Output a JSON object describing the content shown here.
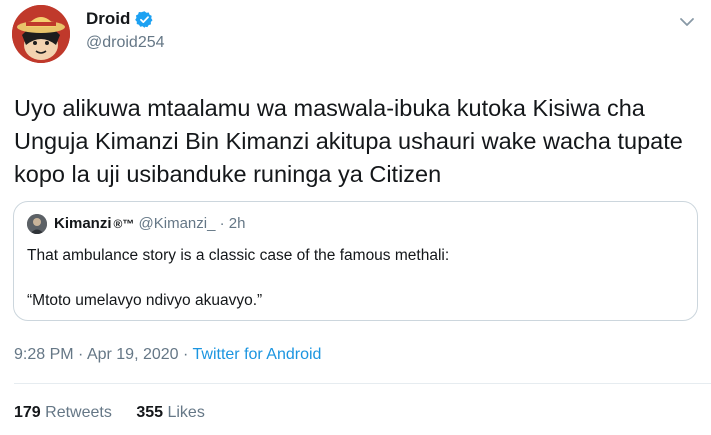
{
  "author": {
    "name": "Droid",
    "handle": "@droid254",
    "verified": true
  },
  "tweet": {
    "text": "Uyo alikuwa mtaalamu wa maswala-ibuka kutoka Kisiwa cha Unguja Kimanzi Bin Kimanzi akitupa ushauri wake wacha tupate kopo la uji usibanduke runinga ya Citizen"
  },
  "quoted": {
    "name": "Kimanzi",
    "name_suffix": "®™",
    "handle": "@Kimanzi_",
    "separator": "·",
    "time": "2h",
    "line1": "That ambulance story is a classic case of the famous methali:",
    "line2": "“Mtoto umelavyo ndivyo akuavyo.”"
  },
  "meta": {
    "time": "9:28 PM",
    "sep1": "·",
    "date": "Apr 19, 2020",
    "sep2": "·",
    "source": "Twitter for Android"
  },
  "stats": {
    "retweets_count": "179",
    "retweets_label": "Retweets",
    "likes_count": "355",
    "likes_label": "Likes"
  },
  "colors": {
    "accent": "#1b95e0",
    "verified": "#1da1f2",
    "secondary_text": "#657786",
    "border": "#ccd6dd"
  },
  "icons": {
    "verified": "verified-badge-icon",
    "menu": "chevron-down-icon"
  }
}
